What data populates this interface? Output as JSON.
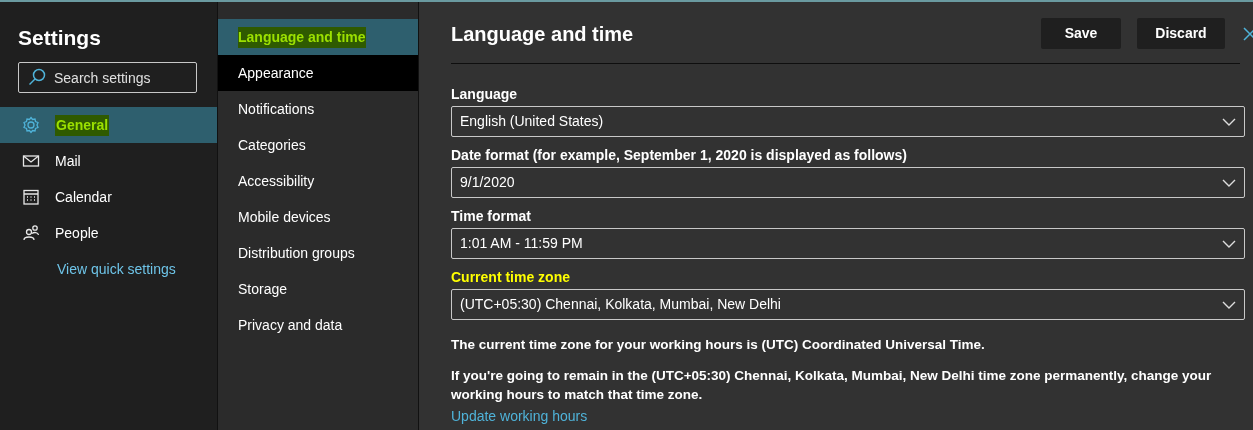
{
  "sidebar": {
    "title": "Settings",
    "search": {
      "placeholder": "Search settings"
    },
    "items": [
      {
        "label": "General",
        "selected": true,
        "highlighted": true
      },
      {
        "label": "Mail",
        "selected": false,
        "highlighted": false
      },
      {
        "label": "Calendar",
        "selected": false,
        "highlighted": false
      },
      {
        "label": "People",
        "selected": false,
        "highlighted": false
      }
    ],
    "link": "View quick settings"
  },
  "subnav": {
    "items": [
      {
        "label": "Language and time",
        "selected": true,
        "hovered": false,
        "highlighted": true
      },
      {
        "label": "Appearance",
        "selected": false,
        "hovered": true,
        "highlighted": false
      },
      {
        "label": "Notifications",
        "selected": false,
        "hovered": false,
        "highlighted": false
      },
      {
        "label": "Categories",
        "selected": false,
        "hovered": false,
        "highlighted": false
      },
      {
        "label": "Accessibility",
        "selected": false,
        "hovered": false,
        "highlighted": false
      },
      {
        "label": "Mobile devices",
        "selected": false,
        "hovered": false,
        "highlighted": false
      },
      {
        "label": "Distribution groups",
        "selected": false,
        "hovered": false,
        "highlighted": false
      },
      {
        "label": "Storage",
        "selected": false,
        "hovered": false,
        "highlighted": false
      },
      {
        "label": "Privacy and data",
        "selected": false,
        "hovered": false,
        "highlighted": false
      }
    ]
  },
  "panel": {
    "title": "Language and time",
    "buttons": [
      "Save",
      "Discard"
    ],
    "fields": [
      {
        "label": "Language",
        "value": "English (United States)",
        "highlighted": false
      },
      {
        "label": "Date format (for example, September 1, 2020 is displayed as follows)",
        "value": "9/1/2020",
        "highlighted": false
      },
      {
        "label": "Time format",
        "value": "1:01 AM - 11:59 PM",
        "highlighted": false
      },
      {
        "label": "Current time zone",
        "value": "(UTC+05:30) Chennai, Kolkata, Mumbai, New Delhi",
        "highlighted": true
      }
    ],
    "notes": [
      "The current time zone for your working hours is (UTC) Coordinated Universal Time.",
      "If you're going to remain in the (UTC+05:30) Chennai, Kolkata, Mumbai, New Delhi time zone permanently, change your working hours to match that time zone."
    ],
    "link": "Update working hours"
  }
}
